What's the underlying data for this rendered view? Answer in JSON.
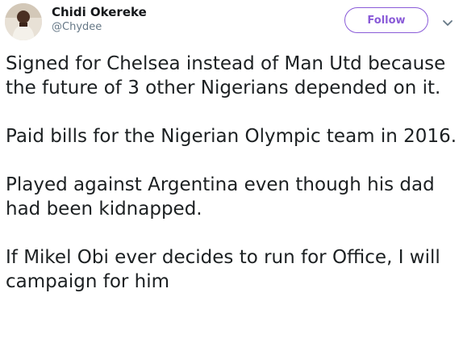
{
  "user": {
    "display_name": "Chidi Okereke",
    "handle": "@Chydee",
    "avatar_icon": "profile-photo"
  },
  "actions": {
    "follow_label": "Follow",
    "menu_icon": "chevron-down-icon"
  },
  "colors": {
    "accent": "#8a5bd8",
    "handle": "#657786",
    "text": "#1c2022"
  },
  "tweet": {
    "paragraphs": [
      "Signed for Chelsea instead of Man Utd because the future of 3 other Nigerians depended on it.",
      "Paid bills for the Nigerian Olympic team in 2016.",
      "Played against Argentina even though his dad had been kidnapped.",
      "If Mikel Obi ever decides to run for Office, I will campaign for him"
    ]
  }
}
